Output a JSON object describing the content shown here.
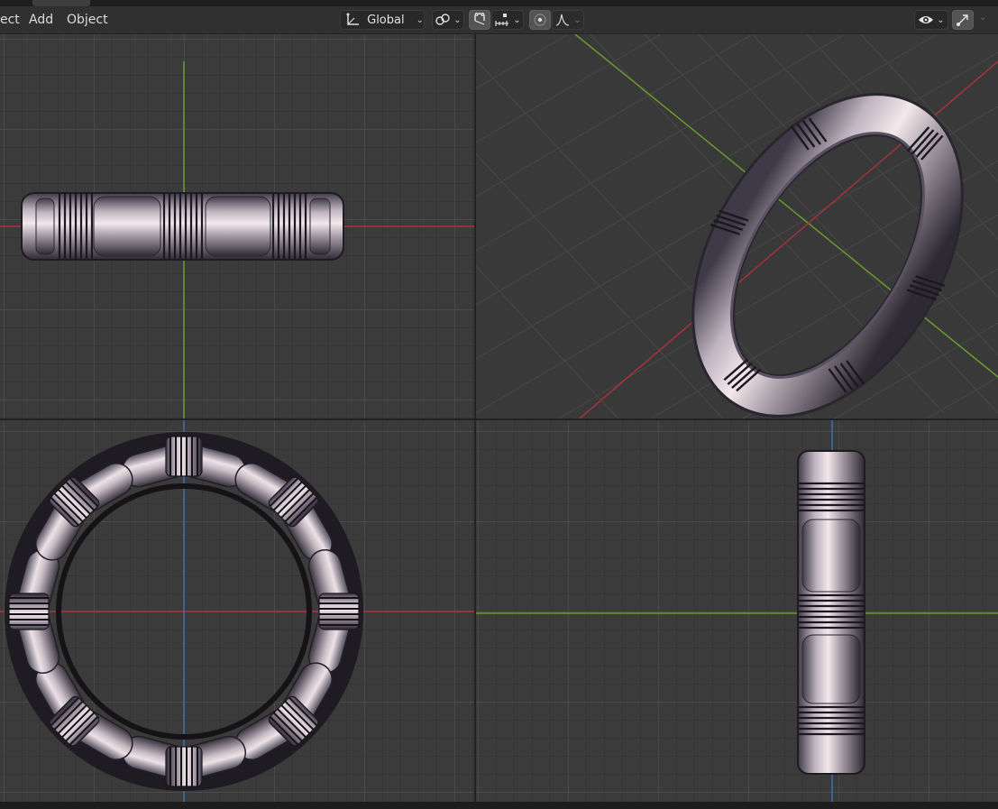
{
  "menu": {
    "select_partial": "ect",
    "add": "Add",
    "object": "Object"
  },
  "toolbar": {
    "transform_orientation": "Global",
    "pivot_icon": "pivot-link-icon",
    "snap_icon": "snap-magnet-icon",
    "snap_target_icon": "snap-increment-icon",
    "proportional_icon": "proportional-edit-icon",
    "falloff_icon": "falloff-curve-icon",
    "visibility_icon": "eye-icon",
    "gizmo_icon": "gizmo-toggle-icon"
  },
  "viewports": [
    {
      "name": "front-view",
      "object": "ring-band-side"
    },
    {
      "name": "user-perspective",
      "object": "ring-band-perspective"
    },
    {
      "name": "top-view",
      "object": "ring-band-circle"
    },
    {
      "name": "right-view",
      "object": "ring-band-vertical"
    }
  ],
  "colors": {
    "x_axis": "#a5343c",
    "y_axis": "#6b9a2e",
    "z_axis": "#3d6ea8",
    "background": "#3b3b3b"
  }
}
